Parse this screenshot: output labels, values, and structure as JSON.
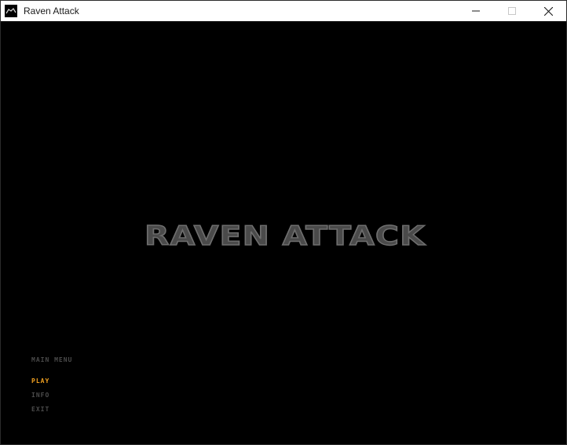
{
  "window": {
    "title": "Raven Attack",
    "icon": "raven-app-icon",
    "controls": [
      "minimize-icon",
      "maximize-icon",
      "close-icon"
    ]
  },
  "game": {
    "logo_text": "RAVEN ATTACK",
    "menu": {
      "heading": "MAIN MENU",
      "items": [
        {
          "label": "PLAY",
          "selected": true
        },
        {
          "label": "INFO",
          "selected": false
        },
        {
          "label": "EXIT",
          "selected": false
        }
      ]
    }
  },
  "colors": {
    "background": "#000000",
    "selected_item": "#f0a020",
    "menu_text": "#4c4c4c",
    "logo": "#4a4a4a"
  }
}
